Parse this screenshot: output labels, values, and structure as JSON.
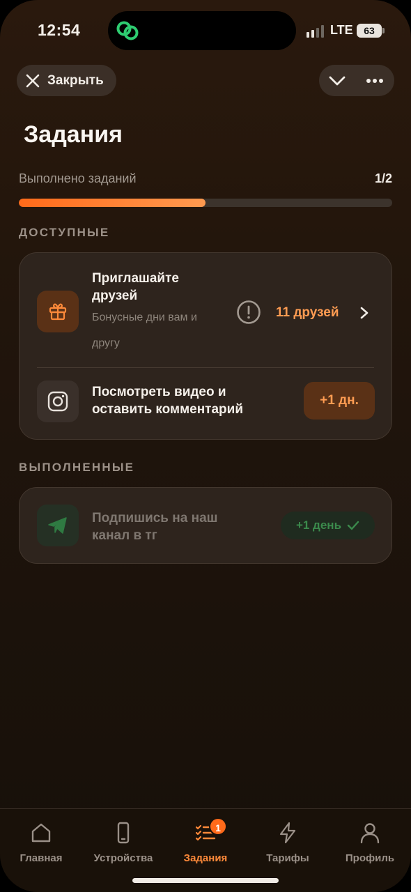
{
  "status_bar": {
    "time": "12:54",
    "network": "LTE",
    "battery": "63"
  },
  "header": {
    "close_label": "Закрыть",
    "title": "Задания"
  },
  "progress": {
    "label": "Выполнено заданий",
    "count": "1/2",
    "completed": 1,
    "total": 2
  },
  "sections": {
    "available": {
      "label": "ДОСТУПНЫЕ",
      "tasks": [
        {
          "title_line1": "Приглашайте",
          "title_line2": "друзей",
          "subtitle_line1": "Бонусные дни вам и",
          "subtitle_line2": "другу",
          "icon": "gift-icon",
          "counter": "11 друзей"
        },
        {
          "title_line1": "Посмотреть видео и",
          "title_line2": "оставить комментарий",
          "icon": "instagram-icon",
          "reward": "+1 дн."
        }
      ]
    },
    "completed": {
      "label": "ВЫПОЛНЕННЫЕ",
      "tasks": [
        {
          "title_line1": "Подпишись на наш",
          "title_line2": "канал в тг",
          "icon": "telegram-icon",
          "reward": "+1 день"
        }
      ]
    }
  },
  "tabbar": {
    "items": [
      {
        "label": "Главная",
        "icon": "home-icon"
      },
      {
        "label": "Устройства",
        "icon": "phone-icon"
      },
      {
        "label": "Задания",
        "icon": "tasks-icon",
        "badge": "1"
      },
      {
        "label": "Тарифы",
        "icon": "lightning-icon"
      },
      {
        "label": "Профиль",
        "icon": "profile-icon"
      }
    ],
    "active_index": 2
  },
  "colors": {
    "accent": "#ff8a3a",
    "success": "#3b8a4c",
    "card_bg": "#2e241d"
  }
}
